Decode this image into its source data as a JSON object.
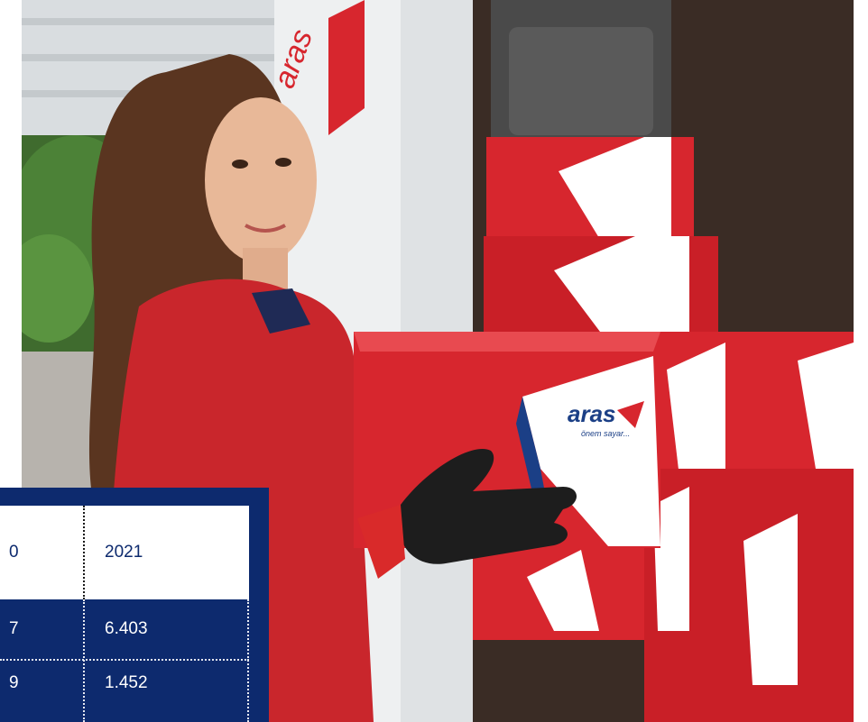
{
  "image": {
    "description_icon": "photo",
    "box_brand_text": "aras",
    "box_slogan_text": "önem sayar..."
  },
  "table": {
    "columns": [
      "0",
      "2021"
    ],
    "rows": [
      [
        "7",
        "6.403"
      ],
      [
        "9",
        "1.452"
      ]
    ]
  },
  "colors": {
    "table_bg": "#0d2a6e",
    "brand_red": "#d7262e",
    "header_bg": "#ffffff"
  }
}
